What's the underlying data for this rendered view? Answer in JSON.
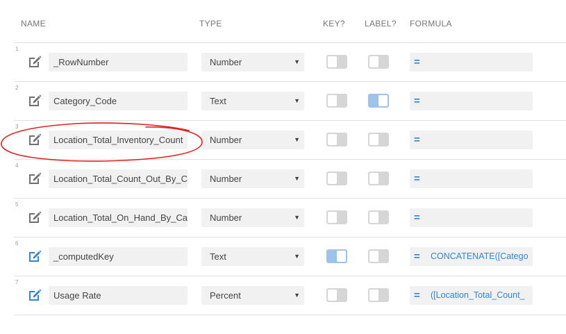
{
  "headers": {
    "name": "NAME",
    "type": "TYPE",
    "key": "KEY?",
    "label": "LABEL?",
    "formula": "FORMULA"
  },
  "rows": [
    {
      "num": "1",
      "name": "_RowNumber",
      "type": "Number",
      "key": false,
      "label": false,
      "formula": "",
      "edit_color": "#707070"
    },
    {
      "num": "2",
      "name": "Category_Code",
      "type": "Text",
      "key": false,
      "label": true,
      "formula": "",
      "edit_color": "#707070"
    },
    {
      "num": "3",
      "name": "Location_Total_Inventory_Count",
      "type": "Number",
      "key": false,
      "label": false,
      "formula": "",
      "edit_color": "#707070"
    },
    {
      "num": "4",
      "name": "Location_Total_Count_Out_By_C",
      "type": "Number",
      "key": false,
      "label": false,
      "formula": "",
      "edit_color": "#707070"
    },
    {
      "num": "5",
      "name": "Location_Total_On_Hand_By_Ca",
      "type": "Number",
      "key": false,
      "label": false,
      "formula": "",
      "edit_color": "#707070"
    },
    {
      "num": "6",
      "name": "_computedKey",
      "type": "Text",
      "key": true,
      "label": false,
      "formula": "CONCATENATE([Catego",
      "edit_color": "#2e86d4"
    },
    {
      "num": "7",
      "name": "Usage Rate",
      "type": "Percent",
      "key": false,
      "label": false,
      "formula": "([Location_Total_Count_",
      "edit_color": "#2e86d4"
    }
  ],
  "formula_symbol": "=",
  "colors": {
    "accent": "#2e86d4",
    "toggle_on": "#9dc3ea",
    "toggle_off": "#d6d6d6",
    "annotation": "#e0201c"
  }
}
